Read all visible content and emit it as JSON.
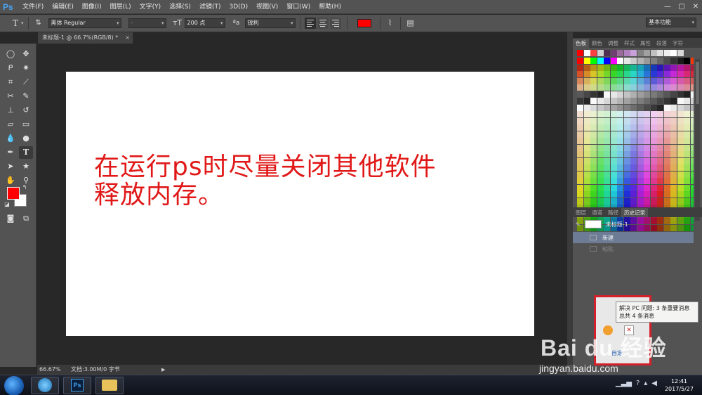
{
  "app": {
    "logo": "Ps",
    "menu": [
      "文件(F)",
      "编辑(E)",
      "图像(I)",
      "图层(L)",
      "文字(Y)",
      "选择(S)",
      "滤镜(T)",
      "3D(D)",
      "视图(V)",
      "窗口(W)",
      "帮助(H)"
    ],
    "window_controls": [
      "—",
      "▢",
      "✕"
    ]
  },
  "options_bar": {
    "font_family": "黑体 Regular",
    "font_style": "-",
    "font_size": "200 点",
    "antialias": "锐利",
    "text_color": "#ff0000",
    "workspace": "基本功能"
  },
  "document": {
    "tab_title": "未标题-1 @ 66.7%(RGB/8) *",
    "tab_close": "×",
    "canvas_text_line1": "在运行ps时尽量关闭其他软件",
    "canvas_text_line2": "释放内存。",
    "text_color": "#e11818"
  },
  "tools": {
    "foreground": "#ff0000",
    "background": "#ffffff"
  },
  "swatches_panel": {
    "tabs": [
      "色板",
      "颜色",
      "调整",
      "样式",
      "属性",
      "段落",
      "字符"
    ],
    "active_tab": "色板"
  },
  "history_panel": {
    "tabs": [
      "图层",
      "通道",
      "路径",
      "历史记录"
    ],
    "active_tab": "历史记录",
    "snapshot": "未标题-1",
    "steps": [
      {
        "label": "新建",
        "state": "active"
      },
      {
        "label": "粘贴",
        "state": "undone"
      }
    ]
  },
  "status_bar": {
    "zoom": "66.67%",
    "doc_info": "文档:3.00M/0 字节",
    "arrow": "▶"
  },
  "notification": {
    "line1": "解决 PC 问题: 3 条重要消息",
    "line2": "总共 4 条消息",
    "customize": "自定..."
  },
  "watermark": {
    "logo": "Bai du 经验",
    "url": "jingyan.baidu.com"
  },
  "taskbar": {
    "apps": [
      "Ps"
    ],
    "clock_time": "12:41",
    "clock_date": "2017/5/27"
  }
}
